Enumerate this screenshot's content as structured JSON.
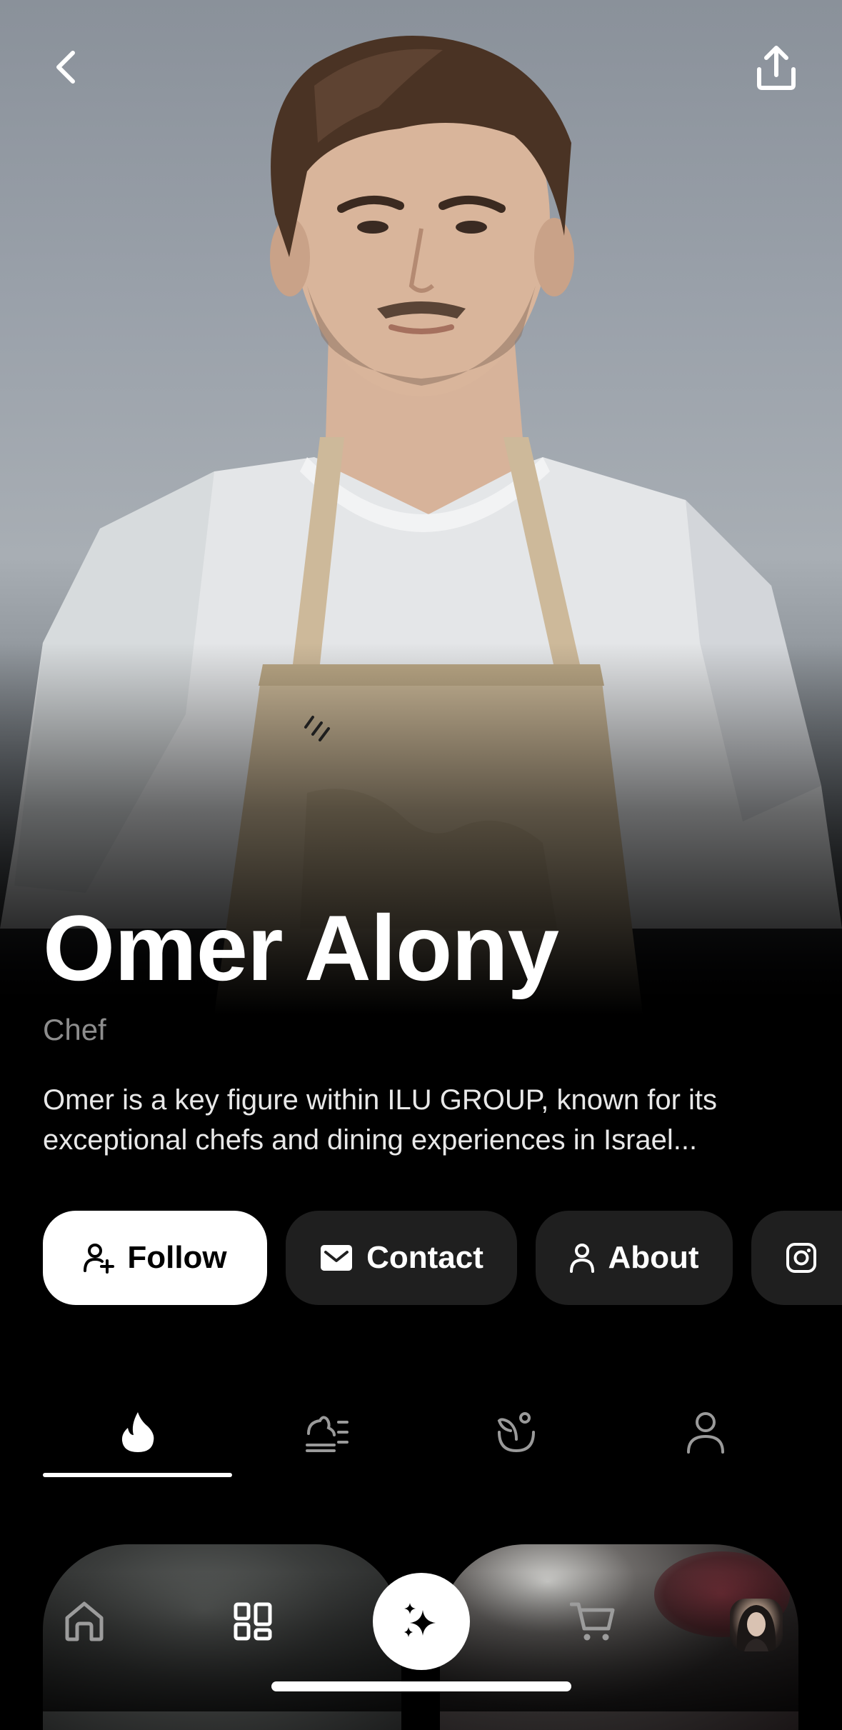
{
  "header": {
    "back_icon": "chevron-left-icon",
    "share_icon": "share-upload-icon"
  },
  "profile": {
    "name": "Omer Alony",
    "role": "Chef",
    "bio": "Omer is a key figure within ILU GROUP, known for its exceptional chefs and dining experiences in Israel..."
  },
  "actions": {
    "follow_label": "Follow",
    "contact_label": "Contact",
    "about_label": "About",
    "instagram_icon": "instagram-icon"
  },
  "tabs": [
    {
      "icon": "flame-icon",
      "active": true
    },
    {
      "icon": "dish-list-icon",
      "active": false
    },
    {
      "icon": "bowl-sprout-icon",
      "active": false
    },
    {
      "icon": "person-icon",
      "active": false
    }
  ],
  "bottom_nav": [
    {
      "icon": "home-icon"
    },
    {
      "icon": "grid-icon"
    },
    {
      "icon": "sparkle-icon"
    },
    {
      "icon": "cart-icon"
    },
    {
      "icon": "profile-avatar"
    }
  ],
  "colors": {
    "background": "#000000",
    "pill": "#1f1f1f",
    "follow_bg": "#ffffff",
    "muted_text": "#8d8d8d"
  }
}
